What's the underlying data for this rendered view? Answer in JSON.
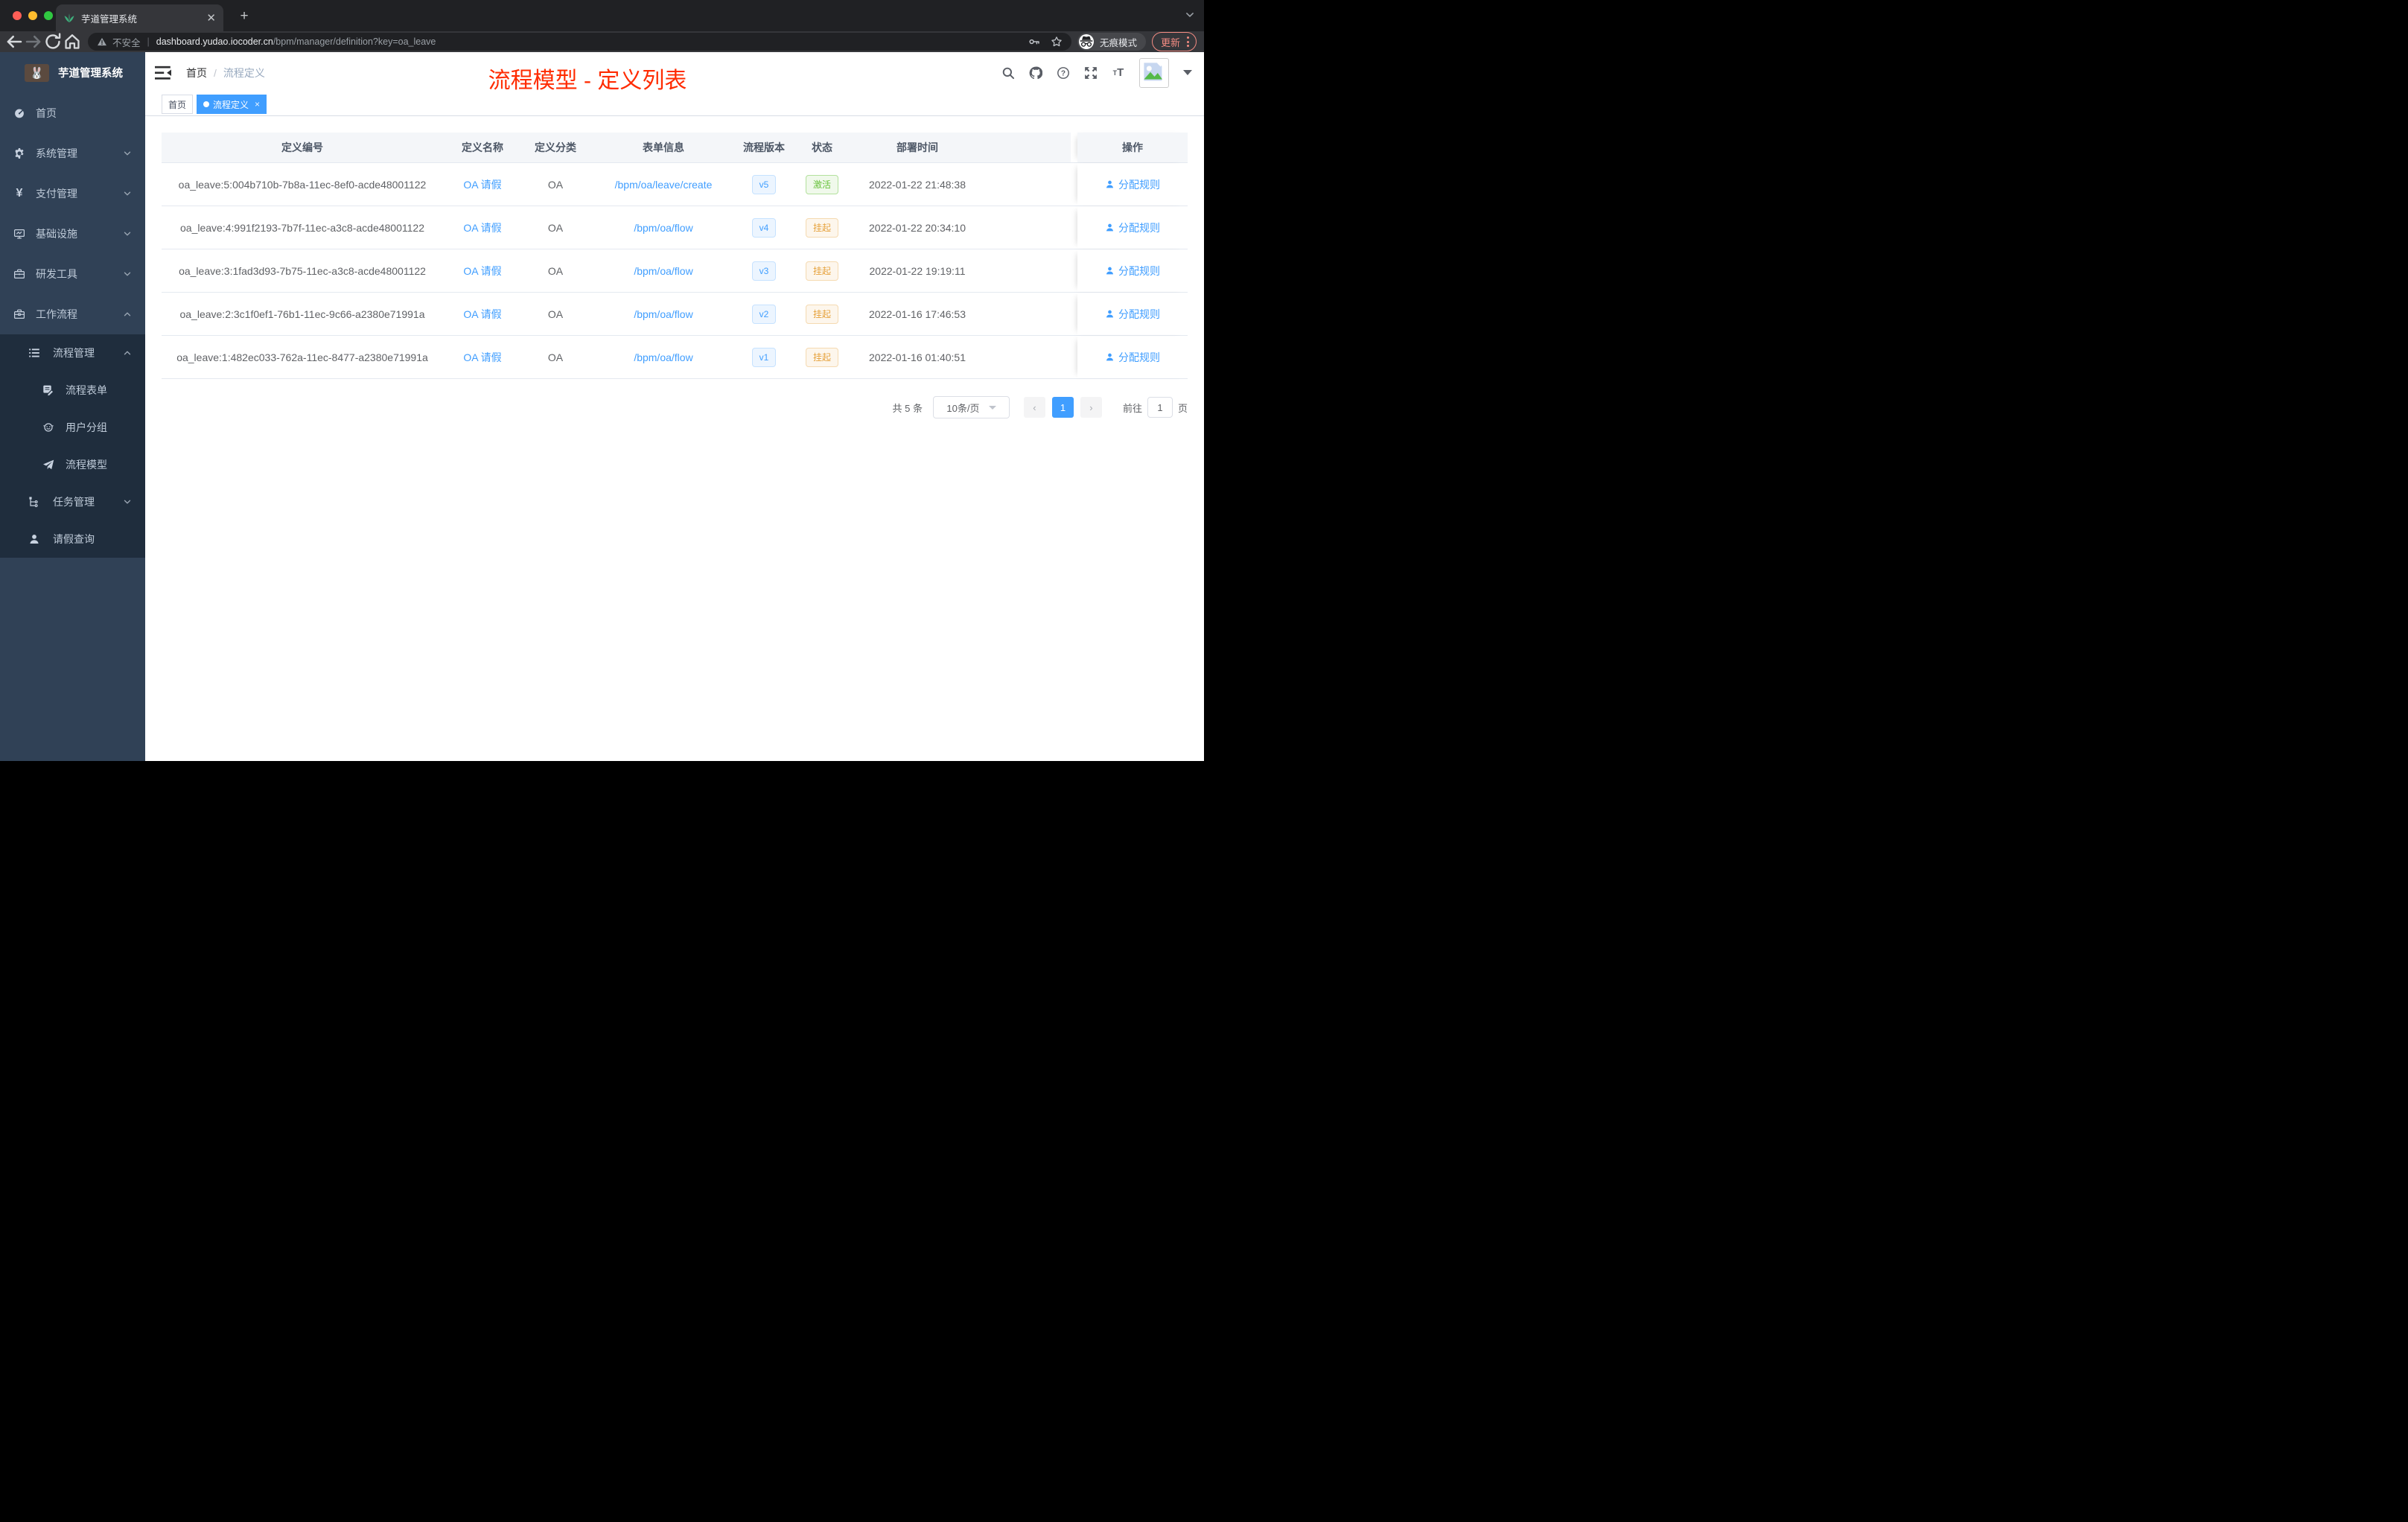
{
  "browser": {
    "tab_title": "芋道管理系统",
    "url": {
      "security_label": "不安全",
      "host": "dashboard.yudao.iocoder.cn",
      "path": "/bpm/manager/definition?key=oa_leave"
    },
    "incognito_label": "无痕模式",
    "update_label": "更新"
  },
  "sidebar": {
    "app_title": "芋道管理系统",
    "items": [
      {
        "icon": "dashboard-icon",
        "label": "首页",
        "level": 1,
        "chevron": null
      },
      {
        "icon": "gear-icon",
        "label": "系统管理",
        "level": 1,
        "chevron": "down"
      },
      {
        "icon": "yen-icon",
        "label": "支付管理",
        "level": 1,
        "chevron": "down"
      },
      {
        "icon": "monitor-icon",
        "label": "基础设施",
        "level": 1,
        "chevron": "down"
      },
      {
        "icon": "toolbox-icon",
        "label": "研发工具",
        "level": 1,
        "chevron": "down"
      },
      {
        "icon": "briefcase-icon",
        "label": "工作流程",
        "level": 1,
        "chevron": "up"
      },
      {
        "icon": "list-icon",
        "label": "流程管理",
        "level": 2,
        "chevron": "up"
      },
      {
        "icon": "form-icon",
        "label": "流程表单",
        "level": 3,
        "chevron": null
      },
      {
        "icon": "users-icon",
        "label": "用户分组",
        "level": 3,
        "chevron": null
      },
      {
        "icon": "paper-plane-icon",
        "label": "流程模型",
        "level": 3,
        "chevron": null
      },
      {
        "icon": "tree-icon",
        "label": "任务管理",
        "level": 2,
        "chevron": "down"
      },
      {
        "icon": "user-icon",
        "label": "请假查询",
        "level": 2,
        "chevron": null
      }
    ]
  },
  "navbar": {
    "breadcrumb_home": "首页",
    "breadcrumb_separator": "/",
    "breadcrumb_current": "流程定义",
    "annotation": "流程模型 - 定义列表"
  },
  "tags_view": {
    "tabs": [
      {
        "label": "首页",
        "active": false,
        "closable": false
      },
      {
        "label": "流程定义",
        "active": true,
        "closable": true
      }
    ]
  },
  "table": {
    "columns": [
      "定义编号",
      "定义名称",
      "定义分类",
      "表单信息",
      "流程版本",
      "状态",
      "部署时间",
      "操作"
    ],
    "rows": [
      {
        "id": "oa_leave:5:004b710b-7b8a-11ec-8ef0-acde48001122",
        "name": "OA 请假",
        "category": "OA",
        "form": "/bpm/oa/leave/create",
        "version": "v5",
        "status": "激活",
        "status_type": "success",
        "deploy_time": "2022-01-22 21:48:38",
        "action": "分配规则"
      },
      {
        "id": "oa_leave:4:991f2193-7b7f-11ec-a3c8-acde48001122",
        "name": "OA 请假",
        "category": "OA",
        "form": "/bpm/oa/flow",
        "version": "v4",
        "status": "挂起",
        "status_type": "warning",
        "deploy_time": "2022-01-22 20:34:10",
        "action": "分配规则"
      },
      {
        "id": "oa_leave:3:1fad3d93-7b75-11ec-a3c8-acde48001122",
        "name": "OA 请假",
        "category": "OA",
        "form": "/bpm/oa/flow",
        "version": "v3",
        "status": "挂起",
        "status_type": "warning",
        "deploy_time": "2022-01-22 19:19:11",
        "action": "分配规则"
      },
      {
        "id": "oa_leave:2:3c1f0ef1-76b1-11ec-9c66-a2380e71991a",
        "name": "OA 请假",
        "category": "OA",
        "form": "/bpm/oa/flow",
        "version": "v2",
        "status": "挂起",
        "status_type": "warning",
        "deploy_time": "2022-01-16 17:46:53",
        "action": "分配规则"
      },
      {
        "id": "oa_leave:1:482ec033-762a-11ec-8477-a2380e71991a",
        "name": "OA 请假",
        "category": "OA",
        "form": "/bpm/oa/flow",
        "version": "v1",
        "status": "挂起",
        "status_type": "warning",
        "deploy_time": "2022-01-16 01:40:51",
        "action": "分配规则"
      }
    ]
  },
  "pagination": {
    "total_label": "共 5 条",
    "page_size_label": "10条/页",
    "current_page": "1",
    "goto_label": "前往",
    "goto_value": "1",
    "page_unit_label": "页"
  },
  "colors": {
    "accent": "#409eff",
    "annotation": "#ff2b00",
    "success": "#67c23a",
    "warning": "#e6a23c",
    "sidebar_bg": "#304156",
    "submenu_bg": "#1f2d3d"
  }
}
